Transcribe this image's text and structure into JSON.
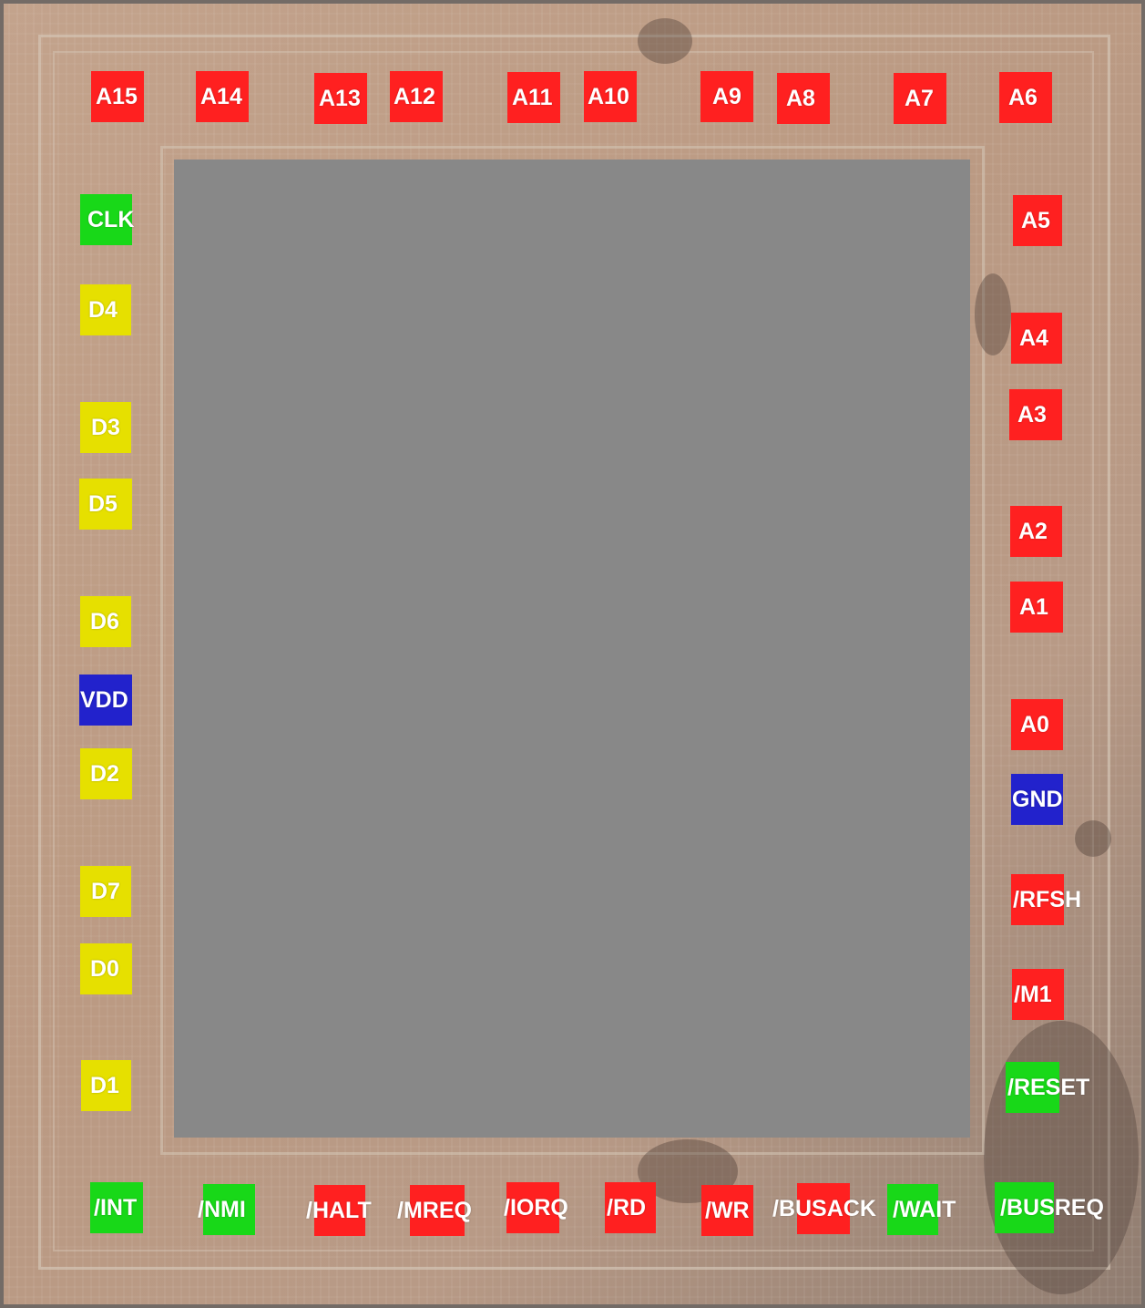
{
  "colors": {
    "address": "#ff2020",
    "data": "#e6e000",
    "input": "#18d818",
    "power": "#2222cc",
    "core": "#888888",
    "die": "#c3a38c"
  },
  "pads": [
    {
      "id": "A15",
      "label": "A15",
      "kind": "address"
    },
    {
      "id": "A14",
      "label": "A14",
      "kind": "address"
    },
    {
      "id": "A13",
      "label": "A13",
      "kind": "address"
    },
    {
      "id": "A12",
      "label": "A12",
      "kind": "address"
    },
    {
      "id": "A11",
      "label": "A11",
      "kind": "address"
    },
    {
      "id": "A10",
      "label": "A10",
      "kind": "address"
    },
    {
      "id": "A9",
      "label": "A9",
      "kind": "address"
    },
    {
      "id": "A8",
      "label": "A8",
      "kind": "address"
    },
    {
      "id": "A7",
      "label": "A7",
      "kind": "address"
    },
    {
      "id": "A6",
      "label": "A6",
      "kind": "address"
    },
    {
      "id": "A5",
      "label": "A5",
      "kind": "address"
    },
    {
      "id": "A4",
      "label": "A4",
      "kind": "address"
    },
    {
      "id": "A3",
      "label": "A3",
      "kind": "address"
    },
    {
      "id": "A2",
      "label": "A2",
      "kind": "address"
    },
    {
      "id": "A1",
      "label": "A1",
      "kind": "address"
    },
    {
      "id": "A0",
      "label": "A0",
      "kind": "address"
    },
    {
      "id": "GND",
      "label": "GND",
      "kind": "power"
    },
    {
      "id": "RFSH",
      "label": "/RFSH",
      "kind": "address"
    },
    {
      "id": "M1",
      "label": "/M1",
      "kind": "address"
    },
    {
      "id": "RESET",
      "label": "/RESET",
      "kind": "input"
    },
    {
      "id": "BUSREQ",
      "label": "/BUSREQ",
      "kind": "input"
    },
    {
      "id": "WAIT",
      "label": "/WAIT",
      "kind": "input"
    },
    {
      "id": "BUSACK",
      "label": "/BUSACK",
      "kind": "address"
    },
    {
      "id": "WR",
      "label": "/WR",
      "kind": "address"
    },
    {
      "id": "RD",
      "label": "/RD",
      "kind": "address"
    },
    {
      "id": "IORQ",
      "label": "/IORQ",
      "kind": "address"
    },
    {
      "id": "MREQ",
      "label": "/MREQ",
      "kind": "address"
    },
    {
      "id": "HALT",
      "label": "/HALT",
      "kind": "address"
    },
    {
      "id": "NMI",
      "label": "/NMI",
      "kind": "input"
    },
    {
      "id": "INT",
      "label": "/INT",
      "kind": "input"
    },
    {
      "id": "CLK",
      "label": "CLK",
      "kind": "input"
    },
    {
      "id": "D4",
      "label": "D4",
      "kind": "data"
    },
    {
      "id": "D3",
      "label": "D3",
      "kind": "data"
    },
    {
      "id": "D5",
      "label": "D5",
      "kind": "data"
    },
    {
      "id": "D6",
      "label": "D6",
      "kind": "data"
    },
    {
      "id": "VDD",
      "label": "VDD",
      "kind": "power"
    },
    {
      "id": "D2",
      "label": "D2",
      "kind": "data"
    },
    {
      "id": "D7",
      "label": "D7",
      "kind": "data"
    },
    {
      "id": "D0",
      "label": "D0",
      "kind": "data"
    },
    {
      "id": "D1",
      "label": "D1",
      "kind": "data"
    }
  ]
}
